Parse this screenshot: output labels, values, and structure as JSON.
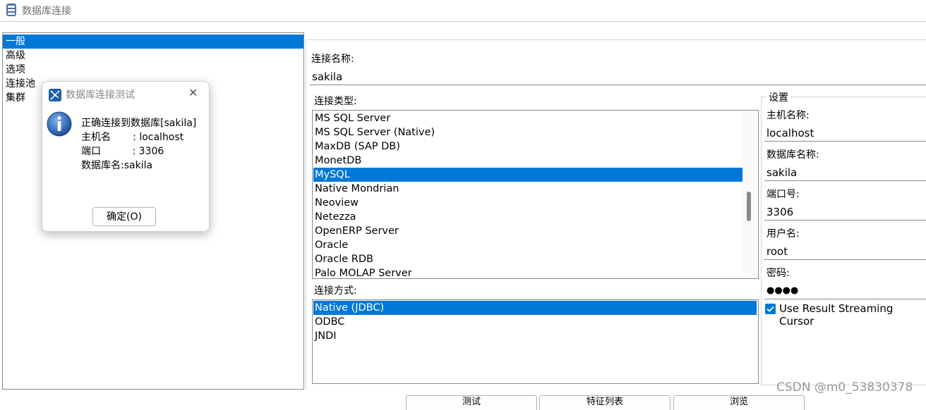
{
  "window": {
    "title": "数据库连接"
  },
  "tree": {
    "items": [
      {
        "label": "一般",
        "selected": true
      },
      {
        "label": "高级",
        "selected": false
      },
      {
        "label": "选项",
        "selected": false
      },
      {
        "label": "连接池",
        "selected": false
      },
      {
        "label": "集群",
        "selected": false
      }
    ]
  },
  "connection": {
    "name_label": "连接名称:",
    "name_value": "sakila",
    "type_label": "连接类型:",
    "types": [
      {
        "label": "MS SQL Server",
        "selected": false
      },
      {
        "label": "MS SQL Server (Native)",
        "selected": false
      },
      {
        "label": "MaxDB (SAP DB)",
        "selected": false
      },
      {
        "label": "MonetDB",
        "selected": false
      },
      {
        "label": "MySQL",
        "selected": true
      },
      {
        "label": "Native Mondrian",
        "selected": false
      },
      {
        "label": "Neoview",
        "selected": false
      },
      {
        "label": "Netezza",
        "selected": false
      },
      {
        "label": "OpenERP Server",
        "selected": false
      },
      {
        "label": "Oracle",
        "selected": false
      },
      {
        "label": "Oracle RDB",
        "selected": false
      },
      {
        "label": "Palo MOLAP Server",
        "selected": false
      }
    ],
    "access_label": "连接方式:",
    "access_methods": [
      {
        "label": "Native (JDBC)",
        "selected": true
      },
      {
        "label": "ODBC",
        "selected": false
      },
      {
        "label": "JNDI",
        "selected": false
      }
    ]
  },
  "settings": {
    "legend": "设置",
    "host_label": "主机名称:",
    "host_value": "localhost",
    "db_label": "数据库名称:",
    "db_value": "sakila",
    "port_label": "端口号:",
    "port_value": "3306",
    "user_label": "用户名:",
    "user_value": "root",
    "password_label": "密码:",
    "password_value": "●●●●",
    "streaming_label": "Use Result Streaming Cursor",
    "streaming_checked": true
  },
  "buttons": {
    "test": "测试",
    "explore": "特征列表",
    "browse": "浏览"
  },
  "dialog": {
    "title": "数据库连接测试",
    "close": "✕",
    "lines": [
      "正确连接到数据库[sakila]",
      "主机名       : localhost",
      "端口          : 3306",
      "数据库名:sakila"
    ],
    "ok": "确定(O)"
  },
  "watermark": "CSDN @m0_53830378",
  "colors": {
    "selection": "#0078d7",
    "border": "#8a8a8a"
  }
}
